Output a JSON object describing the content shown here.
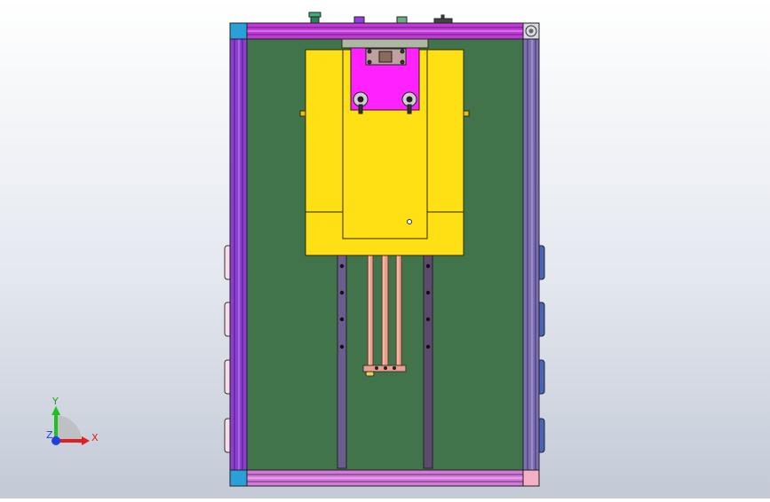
{
  "viewport": {
    "title": ""
  },
  "triad": {
    "x_label": "X",
    "y_label": "Y",
    "z_label": "Z"
  },
  "colors": {
    "background_top": "#ffffff",
    "background_bottom": "#c3cad6",
    "base_plate": "#41744b",
    "frame_purple": "#8a3fd0",
    "frame_magenta": "#b83ad4",
    "carriage_yellow": "#ffe014",
    "clamp_magenta": "#ff22ff",
    "rail_slate": "#6b5e8f",
    "rod_copper": "#e8a08c",
    "corner_cyan": "#2aa0d8",
    "corner_pink": "#f4b0c4",
    "axis_x": "#e02020",
    "axis_y": "#20c020",
    "axis_z": "#2040e0"
  },
  "components": [
    "base-plate",
    "top-frame-rail",
    "bottom-frame-rail",
    "left-frame-rail",
    "right-frame-rail",
    "yellow-carriage",
    "magenta-clamp-block",
    "linear-guide-rail-left",
    "linear-guide-rail-right",
    "copper-rod-1",
    "copper-rod-2",
    "copper-rod-3",
    "rod-end-plate"
  ]
}
